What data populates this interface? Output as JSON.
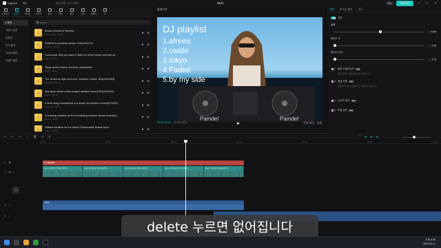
{
  "titlebar": {
    "app_name": "CapCut",
    "menu_label": "메뉴",
    "draft_status": "자동 저장: 임시 파일",
    "project_name": "0911",
    "pro_label": "Pro",
    "export_label": "내보내기"
  },
  "tool_tabs": [
    {
      "label": "가져오기",
      "icon": "import-icon"
    },
    {
      "label": "오디오",
      "icon": "music-icon"
    },
    {
      "label": "텍스트",
      "icon": "text-icon"
    },
    {
      "label": "스티커",
      "icon": "sticker-icon"
    },
    {
      "label": "효과",
      "icon": "effects-icon"
    },
    {
      "label": "전환",
      "icon": "transition-icon"
    },
    {
      "label": "필터",
      "icon": "filter-icon"
    },
    {
      "label": "조정",
      "icon": "adjust-icon"
    },
    {
      "label": "템플릿",
      "icon": "template-icon"
    },
    {
      "label": "AI",
      "icon": "ai-icon"
    }
  ],
  "categories": [
    "▸ 음악",
    "사운드 효과",
    "저작권",
    "인디 음악",
    "TikTok 음악",
    "브랜드 음악"
  ],
  "search": {
    "value": "beach"
  },
  "tracks": [
    {
      "title": "Beach (Sound of Waves)",
      "meta": "Ocean Tape · 00:48"
    },
    {
      "title": "Children's excursion beach CM(1331572)",
      "meta": "FUJIYA · 00:30"
    },
    {
      "title": "Cool music that you want to listen to at the beach and feel su...",
      "meta": "Kazu · 02:10"
    },
    {
      "title": "Tokyo at the beach, Summer, beach(949...",
      "meta": "HIRO · 01:22"
    },
    {
      "title": "The Ventures style surf rock, Summer, beach, 60s(1402283)",
      "meta": "SUNSET · 01:44"
    },
    {
      "title": "sea wave beach coast seagull ambient sound SE(1405400)",
      "meta": "Nature · 00:55"
    },
    {
      "title": "A slow song reminiscent of a beach at summer sunset(371599)",
      "meta": "Lazy_sea · 02:31"
    },
    {
      "title": "A relaxing vacation at the everlasting summer beach resort(14...",
      "meta": "Resort · 02:05"
    },
    {
      "title": "Distant vacation on the beach Fashionable Bossa Nova",
      "meta": "Bossa · 01:58"
    }
  ],
  "player": {
    "header": "플레이어",
    "playlist_title": "DJ playlist",
    "playlist_items": [
      "1.afreea",
      "2.castle",
      "3.tokyo",
      "4.Faded",
      "5.by my side"
    ],
    "current_time": "00:00:29:28",
    "total_time": "00:02:43:11",
    "tools": [
      "전체 화면",
      "비율"
    ]
  },
  "properties": {
    "tabs": [
      "기본",
      "보이스 변조",
      "속도"
    ],
    "section_basic": "기본",
    "volume_label": "볼륨",
    "volume_value": "0.0dB",
    "volume_level": 0.5,
    "fadein_label": "페이드 인",
    "fadein_value": "0.0s",
    "fadeout_label": "페이드 아웃",
    "fadeout_value": "0.0s",
    "normalize_label": "음량 노멀라이즈",
    "normalize_note": "원본 음량을 표준 음량으로 조정합니다.",
    "enhance_label": "음성 보정",
    "enhance_note": "잡음을 제거하고 음성을 더 선명하게 만듭니다.",
    "noise_label": "노이즈 제거",
    "separate_label": "보컬 분리",
    "pro_badge": "Pro"
  },
  "timeline": {
    "ruler_labels": [
      "00:00",
      "00:10",
      "00:20",
      "00:30",
      "00:40",
      "00:50",
      "01:00"
    ],
    "text_clip_label": "DJ playlist",
    "video_clips": [
      "Gen-3 Alpha Turbo 4072...",
      "Gen-3 Alpha Turbo 4072...",
      "Gen-3 Alpha Turbo 4072...",
      "Gen-3 Alpha Turbo 4072...",
      "Gen-3 Alpha Turbo 4072..."
    ],
    "audio_clip_label": "이방인",
    "cover_label": "커버"
  },
  "subtitle": "delete 누르면 없어집니다",
  "taskbar": {
    "tray_line1": "오후 6:38",
    "tray_line2": "2024-09-11"
  },
  "colors": {
    "accent": "#1fc7c1",
    "text_clip": "#b9453f",
    "video_clip": "#2d8f8a",
    "audio_clip": "#2f5d96"
  }
}
